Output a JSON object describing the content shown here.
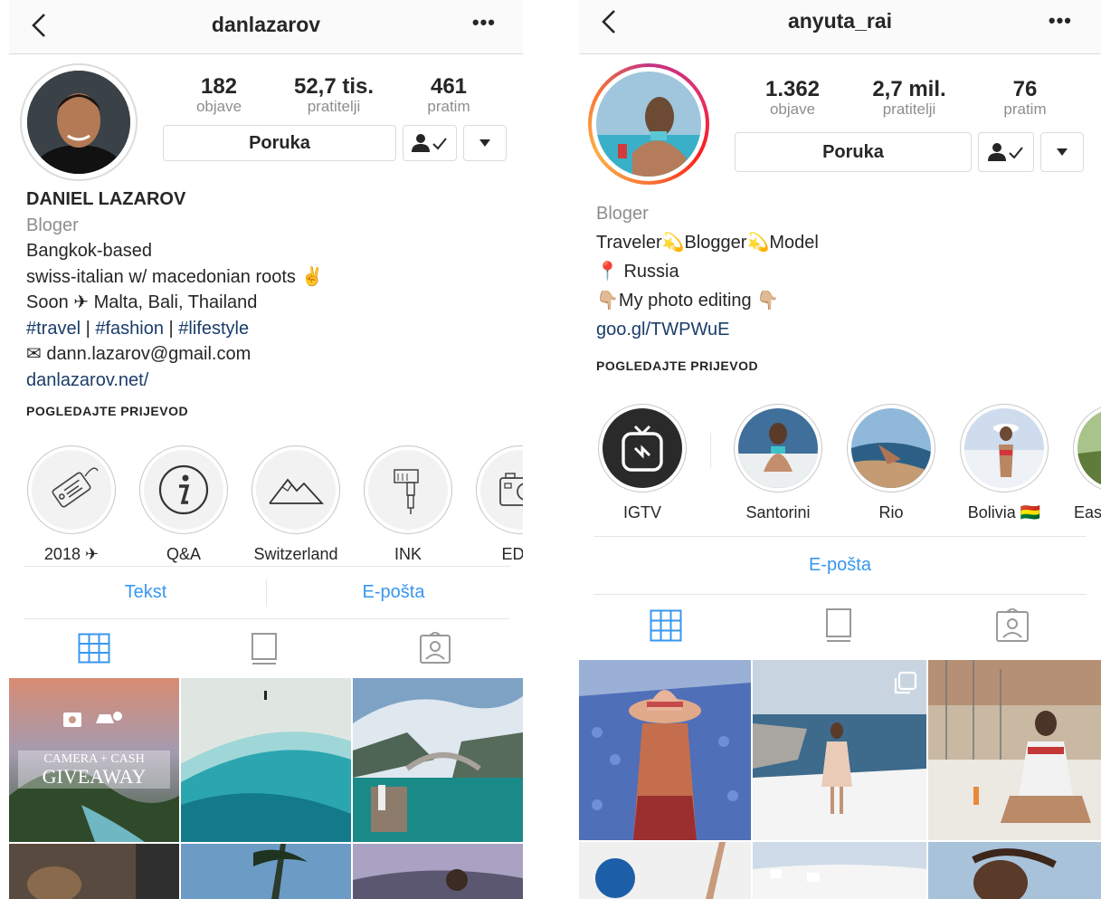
{
  "left": {
    "username": "danlazarov",
    "stats": [
      {
        "value": "182",
        "label": "objave"
      },
      {
        "value": "52,7 tis.",
        "label": "pratitelji"
      },
      {
        "value": "461",
        "label": "pratim"
      }
    ],
    "message_label": "Poruka",
    "bio": {
      "name": "DANIEL LAZAROV",
      "category": "Bloger",
      "lines": [
        "Bangkok-based",
        "swiss-italian w/ macedonian roots ✌",
        "Soon ✈ Malta, Bali, Thailand"
      ],
      "hashtags": [
        "#travel",
        "#fashion",
        "#lifestyle"
      ],
      "hashtag_sep": " | ",
      "email": "✉ dann.lazarov@gmail.com",
      "website": "danlazarov.net/"
    },
    "translate_label": "POGLEDAJTE PRIJEVOD",
    "highlights": [
      {
        "label": "2018 ✈",
        "icon": "tag-icon"
      },
      {
        "label": "Q&A",
        "icon": "info-icon"
      },
      {
        "label": "Switzerland",
        "icon": "mountain-icon"
      },
      {
        "label": "INK",
        "icon": "tattoo-machine-icon"
      },
      {
        "label": "EDIT",
        "icon": "camera-icon"
      }
    ],
    "actions": [
      "Tekst",
      "E-pošta"
    ],
    "giveaway": {
      "line1": "CAMERA + CASH",
      "line2": "GIVEAWAY"
    }
  },
  "right": {
    "username": "anyuta_rai",
    "stats": [
      {
        "value": "1.362",
        "label": "objave"
      },
      {
        "value": "2,7 mil.",
        "label": "pratitelji"
      },
      {
        "value": "76",
        "label": "pratim"
      }
    ],
    "message_label": "Poruka",
    "bio": {
      "category": "Bloger",
      "line1_parts": [
        "Traveler",
        "Blogger",
        "Model"
      ],
      "line1_emoji": "💫",
      "location": "📍 Russia",
      "editing": "👇🏼My photo editing  👇🏼",
      "link": "goo.gl/TWPWuE"
    },
    "translate_label": "POGLEDAJTE PRIJEVOD",
    "highlights": [
      {
        "label": "IGTV",
        "icon": "igtv-icon"
      },
      {
        "label": "Santorini"
      },
      {
        "label": "Rio"
      },
      {
        "label": "Bolivia 🇧🇴"
      },
      {
        "label": "East"
      }
    ],
    "actions": [
      "E-pošta"
    ]
  },
  "colors": {
    "link_blue": "#3897f0",
    "dark_link": "#1b3d69",
    "muted": "#8e8e8e",
    "border": "#dbdbdb"
  }
}
